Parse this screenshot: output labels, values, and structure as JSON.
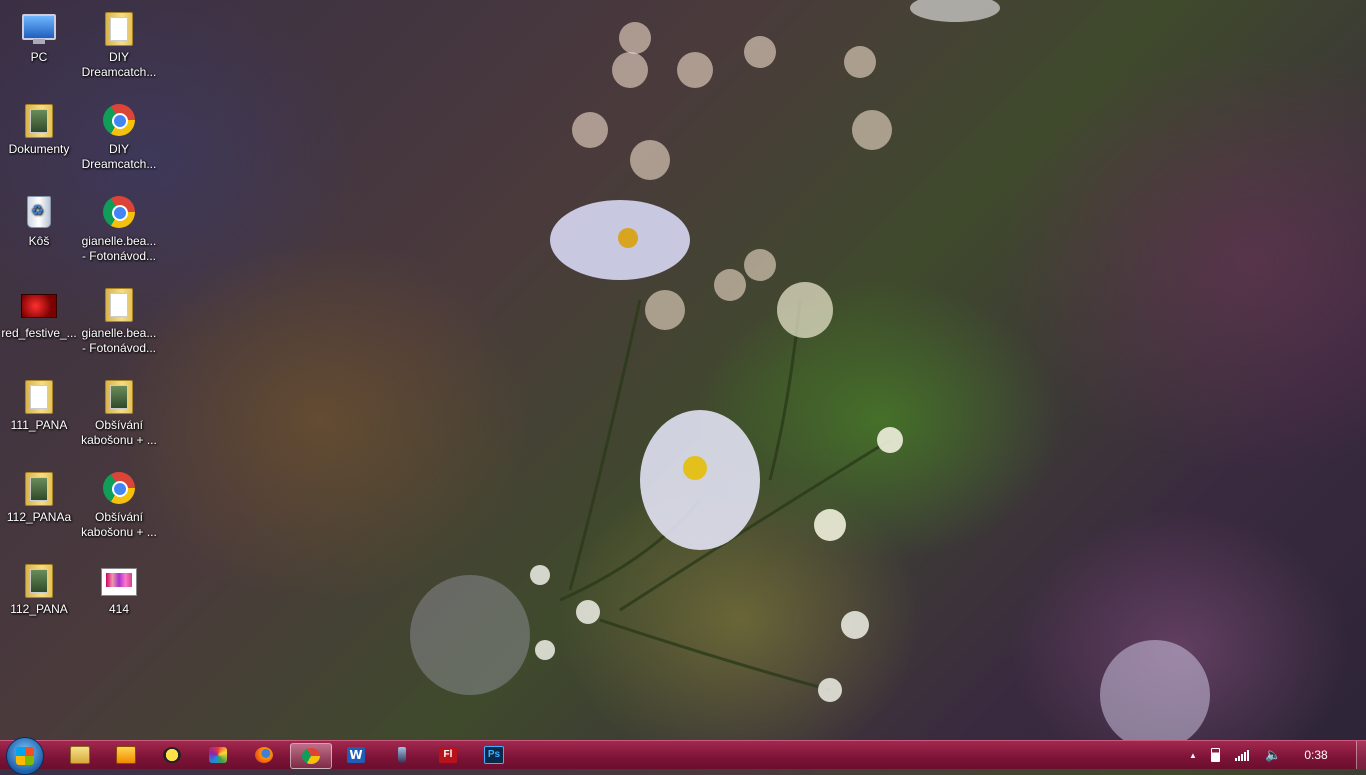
{
  "desktop": {
    "icons": [
      {
        "label": "PC"
      },
      {
        "label": "DIY\nDreamcatch..."
      },
      {
        "label": "Dokumenty"
      },
      {
        "label": "DIY\nDreamcatch..."
      },
      {
        "label": "Kôš"
      },
      {
        "label": "gianelle.bea...\n- Fotonávod..."
      },
      {
        "label": "red_festive_..."
      },
      {
        "label": "gianelle.bea...\n- Fotonávod..."
      },
      {
        "label": "111_PANA"
      },
      {
        "label": "Obšívání\nkabošonu + ..."
      },
      {
        "label": "112_PANAa"
      },
      {
        "label": "Obšívání\nkabošonu + ..."
      },
      {
        "label": "112_PANA"
      },
      {
        "label": "414"
      }
    ]
  },
  "taskbar": {
    "pinned": [
      {
        "name": "file-explorer"
      },
      {
        "name": "media-player"
      },
      {
        "name": "app-yellow"
      },
      {
        "name": "app-colorful"
      },
      {
        "name": "firefox"
      },
      {
        "name": "chrome",
        "active": true
      },
      {
        "name": "word",
        "glyph": "W"
      },
      {
        "name": "pen-tool"
      },
      {
        "name": "flash",
        "glyph": "Fl"
      },
      {
        "name": "photoshop",
        "glyph": "Ps"
      }
    ],
    "tray": {
      "arrow": "▲",
      "clock": "0:38"
    }
  }
}
